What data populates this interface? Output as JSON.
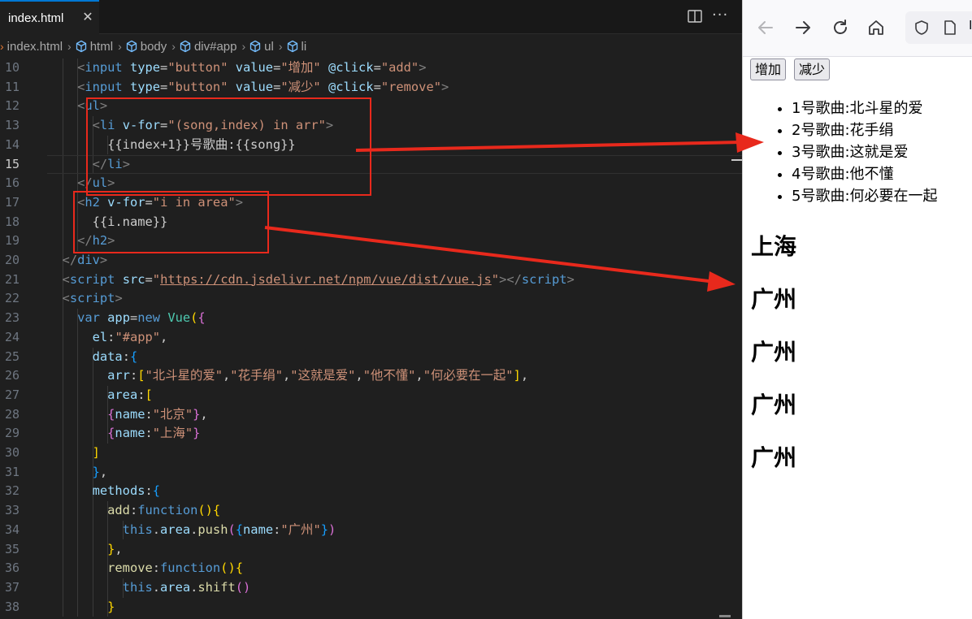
{
  "editor": {
    "tab": {
      "label": "index.html",
      "close": "✕"
    },
    "breadcrumb": [
      "index.html",
      "html",
      "body",
      "div#app",
      "ul",
      "li"
    ],
    "lines": [
      {
        "n": "10",
        "parts": [
          [
            "",
            "    "
          ],
          [
            "tg",
            "<"
          ],
          [
            "tn",
            "input"
          ],
          [
            "at",
            " type"
          ],
          [
            "tx",
            "="
          ],
          [
            "sv",
            "\"button\""
          ],
          [
            "at",
            " value"
          ],
          [
            "tx",
            "="
          ],
          [
            "sv",
            "\"增加\""
          ],
          [
            "at",
            " @click"
          ],
          [
            "tx",
            "="
          ],
          [
            "sv",
            "\"add\""
          ],
          [
            "tg",
            ">"
          ]
        ]
      },
      {
        "n": "11",
        "parts": [
          [
            "",
            "    "
          ],
          [
            "tg",
            "<"
          ],
          [
            "tn",
            "input"
          ],
          [
            "at",
            " type"
          ],
          [
            "tx",
            "="
          ],
          [
            "sv",
            "\"button\""
          ],
          [
            "at",
            " value"
          ],
          [
            "tx",
            "="
          ],
          [
            "sv",
            "\"减少\""
          ],
          [
            "at",
            " @click"
          ],
          [
            "tx",
            "="
          ],
          [
            "sv",
            "\"remove\""
          ],
          [
            "tg",
            ">"
          ]
        ]
      },
      {
        "n": "12",
        "parts": [
          [
            "",
            "    "
          ],
          [
            "tg",
            "<"
          ],
          [
            "tn",
            "ul"
          ],
          [
            "tg",
            ">"
          ]
        ]
      },
      {
        "n": "13",
        "parts": [
          [
            "",
            "      "
          ],
          [
            "tg",
            "<"
          ],
          [
            "tn",
            "li"
          ],
          [
            "at",
            " v-for"
          ],
          [
            "tx",
            "="
          ],
          [
            "sv",
            "\"(song,index) in arr\""
          ],
          [
            "tg",
            ">"
          ]
        ]
      },
      {
        "n": "14",
        "parts": [
          [
            "",
            "        "
          ],
          [
            "tx",
            "{{index+1}}号歌曲:{{song}}"
          ]
        ]
      },
      {
        "n": "15",
        "parts": [
          [
            "",
            "      "
          ],
          [
            "tg",
            "</"
          ],
          [
            "tn",
            "li"
          ],
          [
            "tg",
            ">"
          ]
        ]
      },
      {
        "n": "16",
        "parts": [
          [
            "",
            "    "
          ],
          [
            "tg",
            "</"
          ],
          [
            "tn",
            "ul"
          ],
          [
            "tg",
            ">"
          ]
        ]
      },
      {
        "n": "17",
        "parts": [
          [
            "",
            "    "
          ],
          [
            "tg",
            "<"
          ],
          [
            "tn",
            "h2"
          ],
          [
            "at",
            " v-for"
          ],
          [
            "tx",
            "="
          ],
          [
            "sv",
            "\"i in area\""
          ],
          [
            "tg",
            ">"
          ]
        ]
      },
      {
        "n": "18",
        "parts": [
          [
            "",
            "      "
          ],
          [
            "tx",
            "{{i.name}}"
          ]
        ]
      },
      {
        "n": "19",
        "parts": [
          [
            "",
            "    "
          ],
          [
            "tg",
            "</"
          ],
          [
            "tn",
            "h2"
          ],
          [
            "tg",
            ">"
          ]
        ]
      },
      {
        "n": "20",
        "parts": [
          [
            "",
            "  "
          ],
          [
            "tg",
            "</"
          ],
          [
            "tn",
            "div"
          ],
          [
            "tg",
            ">"
          ]
        ]
      },
      {
        "n": "21",
        "parts": [
          [
            "",
            "  "
          ],
          [
            "tg",
            "<"
          ],
          [
            "tn",
            "script"
          ],
          [
            "at",
            " src"
          ],
          [
            "tx",
            "="
          ],
          [
            "sv",
            "\""
          ],
          [
            "lk",
            "https://cdn.jsdelivr.net/npm/vue/dist/vue.js"
          ],
          [
            "sv",
            "\""
          ],
          [
            "tg",
            "></"
          ],
          [
            "tn",
            "script"
          ],
          [
            "tg",
            ">"
          ]
        ]
      },
      {
        "n": "22",
        "parts": [
          [
            "",
            "  "
          ],
          [
            "tg",
            "<"
          ],
          [
            "tn",
            "script"
          ],
          [
            "tg",
            ">"
          ]
        ]
      },
      {
        "n": "23",
        "parts": [
          [
            "",
            "    "
          ],
          [
            "kw",
            "var"
          ],
          [
            "vr",
            " app"
          ],
          [
            "tx",
            "="
          ],
          [
            "kw",
            "new"
          ],
          [
            "cl",
            " Vue"
          ],
          [
            "br1",
            "("
          ],
          [
            "br2",
            "{"
          ]
        ]
      },
      {
        "n": "24",
        "parts": [
          [
            "",
            "      "
          ],
          [
            "vr",
            "el"
          ],
          [
            "tx",
            ":"
          ],
          [
            "sv",
            "\"#app\""
          ],
          [
            "tx",
            ","
          ]
        ]
      },
      {
        "n": "25",
        "parts": [
          [
            "",
            "      "
          ],
          [
            "vr",
            "data"
          ],
          [
            "tx",
            ":"
          ],
          [
            "br3",
            "{"
          ]
        ]
      },
      {
        "n": "26",
        "parts": [
          [
            "",
            "        "
          ],
          [
            "vr",
            "arr"
          ],
          [
            "tx",
            ":"
          ],
          [
            "br1",
            "["
          ],
          [
            "sv",
            "\"北斗星的爱\""
          ],
          [
            "tx",
            ","
          ],
          [
            "sv",
            "\"花手绢\""
          ],
          [
            "tx",
            ","
          ],
          [
            "sv",
            "\"这就是爱\""
          ],
          [
            "tx",
            ","
          ],
          [
            "sv",
            "\"他不懂\""
          ],
          [
            "tx",
            ","
          ],
          [
            "sv",
            "\"何必要在一起\""
          ],
          [
            "br1",
            "]"
          ],
          [
            "tx",
            ","
          ]
        ]
      },
      {
        "n": "27",
        "parts": [
          [
            "",
            "        "
          ],
          [
            "vr",
            "area"
          ],
          [
            "tx",
            ":"
          ],
          [
            "br1",
            "["
          ]
        ]
      },
      {
        "n": "28",
        "parts": [
          [
            "",
            "        "
          ],
          [
            "br2",
            "{"
          ],
          [
            "vr",
            "name"
          ],
          [
            "tx",
            ":"
          ],
          [
            "sv",
            "\"北京\""
          ],
          [
            "br2",
            "}"
          ],
          [
            "tx",
            ","
          ]
        ]
      },
      {
        "n": "29",
        "parts": [
          [
            "",
            "        "
          ],
          [
            "br2",
            "{"
          ],
          [
            "vr",
            "name"
          ],
          [
            "tx",
            ":"
          ],
          [
            "sv",
            "\"上海\""
          ],
          [
            "br2",
            "}"
          ]
        ]
      },
      {
        "n": "30",
        "parts": [
          [
            "",
            "      "
          ],
          [
            "br1",
            "]"
          ]
        ]
      },
      {
        "n": "31",
        "parts": [
          [
            "",
            "      "
          ],
          [
            "br3",
            "}"
          ],
          [
            "tx",
            ","
          ]
        ]
      },
      {
        "n": "32",
        "parts": [
          [
            "",
            "      "
          ],
          [
            "vr",
            "methods"
          ],
          [
            "tx",
            ":"
          ],
          [
            "br3",
            "{"
          ]
        ]
      },
      {
        "n": "33",
        "parts": [
          [
            "",
            "        "
          ],
          [
            "fn",
            "add"
          ],
          [
            "tx",
            ":"
          ],
          [
            "kw",
            "function"
          ],
          [
            "br1",
            "()"
          ],
          [
            "br1",
            "{"
          ]
        ]
      },
      {
        "n": "34",
        "parts": [
          [
            "",
            "          "
          ],
          [
            "kw",
            "this"
          ],
          [
            "tx",
            "."
          ],
          [
            "vr",
            "area"
          ],
          [
            "tx",
            "."
          ],
          [
            "fn",
            "push"
          ],
          [
            "br2",
            "("
          ],
          [
            "br3",
            "{"
          ],
          [
            "vr",
            "name"
          ],
          [
            "tx",
            ":"
          ],
          [
            "sv",
            "\"广州\""
          ],
          [
            "br3",
            "}"
          ],
          [
            "br2",
            ")"
          ]
        ]
      },
      {
        "n": "35",
        "parts": [
          [
            "",
            "        "
          ],
          [
            "br1",
            "}"
          ],
          [
            "tx",
            ","
          ]
        ]
      },
      {
        "n": "36",
        "parts": [
          [
            "",
            "        "
          ],
          [
            "fn",
            "remove"
          ],
          [
            "tx",
            ":"
          ],
          [
            "kw",
            "function"
          ],
          [
            "br1",
            "()"
          ],
          [
            "br1",
            "{"
          ]
        ]
      },
      {
        "n": "37",
        "parts": [
          [
            "",
            "          "
          ],
          [
            "kw",
            "this"
          ],
          [
            "tx",
            "."
          ],
          [
            "vr",
            "area"
          ],
          [
            "tx",
            "."
          ],
          [
            "fn",
            "shift"
          ],
          [
            "br2",
            "()"
          ]
        ]
      },
      {
        "n": "38",
        "parts": [
          [
            "",
            "        "
          ],
          [
            "br1",
            "}"
          ]
        ]
      }
    ]
  },
  "browser": {
    "address_partial": "I",
    "buttons": {
      "add": "增加",
      "remove": "减少"
    },
    "songs": [
      "1号歌曲:北斗星的爱",
      "2号歌曲:花手绢",
      "3号歌曲:这就是爱",
      "4号歌曲:他不懂",
      "5号歌曲:何必要在一起"
    ],
    "areas": [
      "上海",
      "广州",
      "广州",
      "广州",
      "广州"
    ]
  },
  "colors": {
    "annotation": "#e8291c",
    "editor_bg": "#1f1f1f",
    "accent": "#0078d4"
  }
}
